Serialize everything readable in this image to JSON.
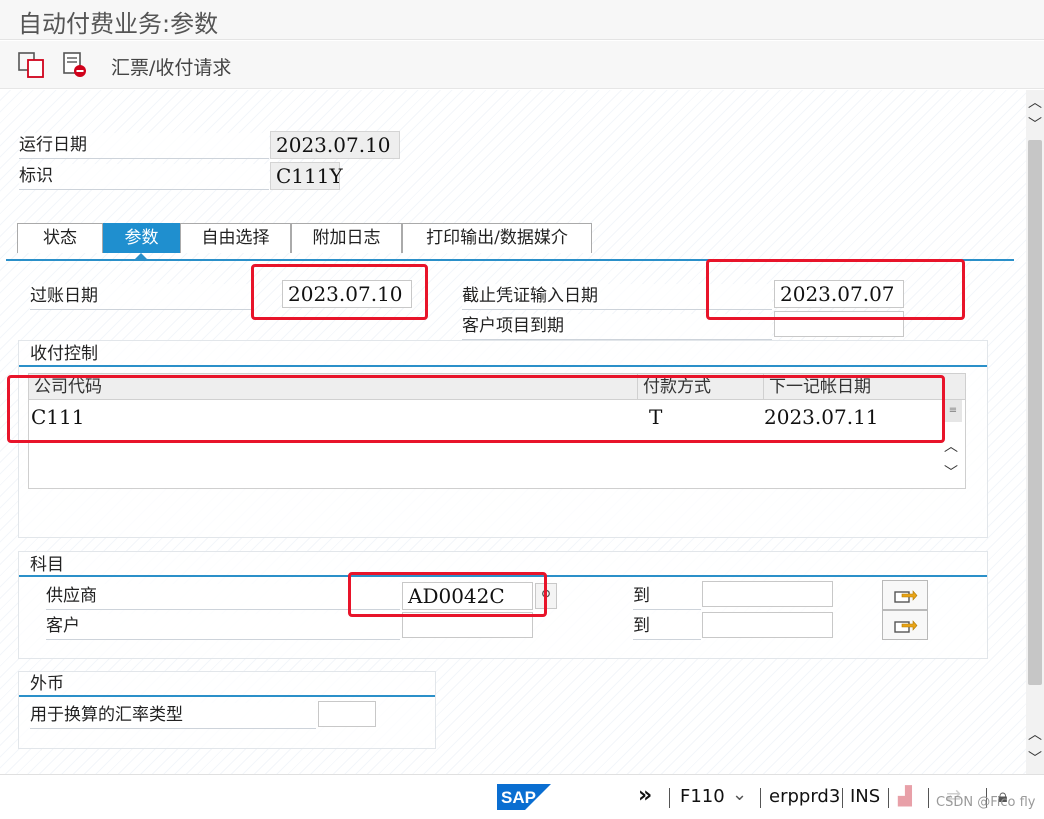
{
  "window": {
    "title": "自动付费业务:参数"
  },
  "toolbar": {
    "label": "汇票/收付请求",
    "icons": [
      "copy-icon",
      "delete-doc-icon"
    ]
  },
  "header": {
    "run_date_label": "运行日期",
    "run_date_value": "2023.07.10",
    "id_label": "标识",
    "id_value": "C111Y"
  },
  "tabs": [
    {
      "label": "状态",
      "active": false
    },
    {
      "label": "参数",
      "active": true
    },
    {
      "label": "自由选择",
      "active": false
    },
    {
      "label": "附加日志",
      "active": false
    },
    {
      "label": "打印输出/数据媒介",
      "active": false
    }
  ],
  "params": {
    "posting_date_label": "过账日期",
    "posting_date_value": "2023.07.10",
    "doc_entry_date_label": "截止凭证输入日期",
    "doc_entry_date_value": "2023.07.07",
    "customer_due_label": "客户项目到期",
    "customer_due_value": ""
  },
  "payment_control": {
    "title": "收付控制",
    "columns": [
      "公司代码",
      "付款方式",
      "下一记帐日期"
    ],
    "rows": [
      {
        "company_code": "C111",
        "payment_method": "T",
        "next_posting_date": "2023.07.11"
      }
    ]
  },
  "accounts": {
    "title": "科目",
    "vendor_label": "供应商",
    "vendor_from": "AD0042C",
    "vendor_to_label": "到",
    "vendor_to": "",
    "customer_label": "客户",
    "customer_from": "",
    "customer_to_label": "到",
    "customer_to": ""
  },
  "foreign_currency": {
    "title": "外币",
    "rate_type_label": "用于换算的汇率类型",
    "rate_type_value": ""
  },
  "statusbar": {
    "logo_text": "SAP",
    "transaction": "F110",
    "system": "erpprd3",
    "mode": "INS",
    "watermark": "CSDN @Fico fly"
  },
  "colors": {
    "accent": "#1f8fcf",
    "highlight": "#e8142a",
    "sap_blue": "#0a6ed1"
  }
}
